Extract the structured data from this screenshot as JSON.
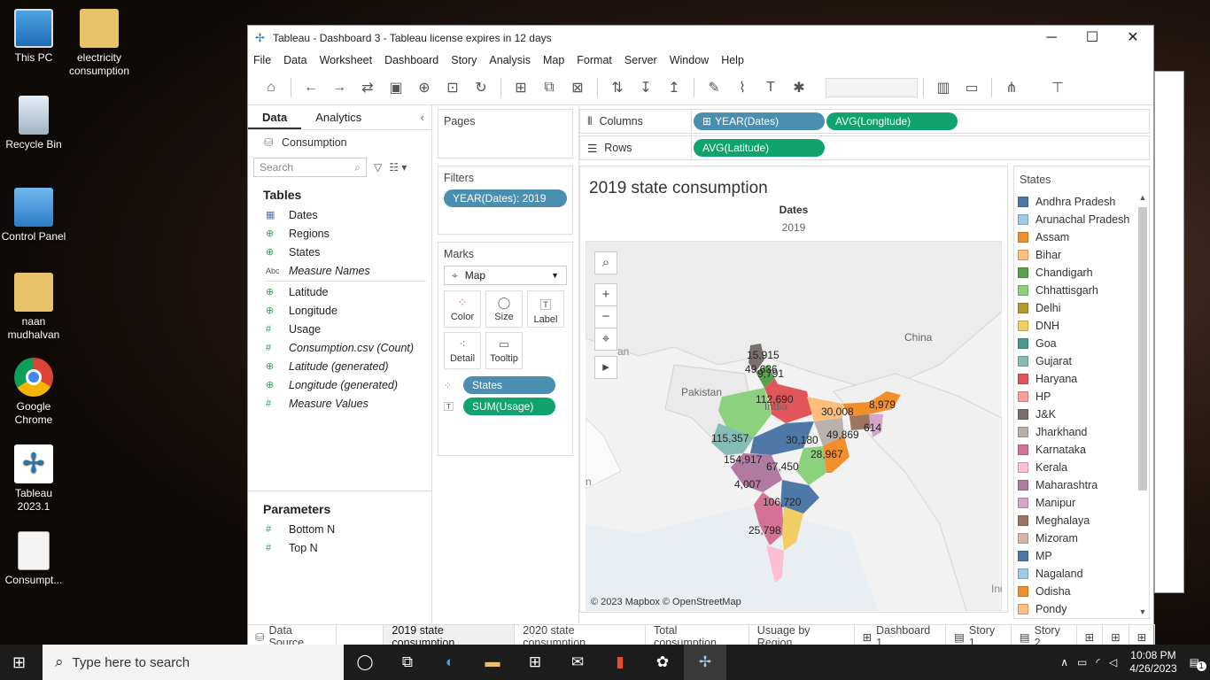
{
  "desktop": {
    "icons": [
      {
        "label": "This PC"
      },
      {
        "label": "electricity consumption"
      },
      {
        "label": "Recycle Bin"
      },
      {
        "label": "Control Panel"
      },
      {
        "label": "naan mudhalvan"
      },
      {
        "label": "Google Chrome"
      },
      {
        "label": "Tableau 2023.1"
      },
      {
        "label": "Consumpt..."
      }
    ]
  },
  "window": {
    "title": "Tableau - Dashboard 3 - Tableau license expires in 12 days",
    "controls": {
      "minimize": "─",
      "maximize": "☐",
      "close": "✕"
    }
  },
  "menu": [
    "File",
    "Data",
    "Worksheet",
    "Dashboard",
    "Story",
    "Analysis",
    "Map",
    "Format",
    "Server",
    "Window",
    "Help"
  ],
  "data_pane": {
    "tabs": [
      "Data",
      "Analytics"
    ],
    "datasource": "Consumption",
    "search_placeholder": "Search",
    "tables_title": "Tables",
    "fields": [
      {
        "name": "Dates",
        "type": "table",
        "italic": false
      },
      {
        "name": "Regions",
        "type": "geo",
        "italic": false
      },
      {
        "name": "States",
        "type": "geo",
        "italic": false
      },
      {
        "name": "Measure Names",
        "type": "abc",
        "italic": true
      },
      {
        "name": "Latitude",
        "type": "geo",
        "italic": false
      },
      {
        "name": "Longitude",
        "type": "geo",
        "italic": false
      },
      {
        "name": "Usage",
        "type": "measure",
        "italic": false
      },
      {
        "name": "Consumption.csv (Count)",
        "type": "measure",
        "italic": true
      },
      {
        "name": "Latitude (generated)",
        "type": "geo",
        "italic": true
      },
      {
        "name": "Longitude (generated)",
        "type": "geo",
        "italic": true
      },
      {
        "name": "Measure Values",
        "type": "measure",
        "italic": true
      }
    ],
    "parameters_title": "Parameters",
    "parameters": [
      "Bottom N",
      "Top N"
    ]
  },
  "cards": {
    "pages_title": "Pages",
    "filters_title": "Filters",
    "filter_pill": "YEAR(Dates): 2019",
    "marks_title": "Marks",
    "mark_type": "Map",
    "mark_buttons": [
      "Color",
      "Size",
      "Label",
      "Detail",
      "Tooltip"
    ],
    "mark_pills": [
      "States",
      "SUM(Usage)"
    ]
  },
  "shelves": {
    "columns_label": "Columns",
    "columns_pills": [
      "YEAR(Dates)",
      "AVG(Longitude)"
    ],
    "rows_label": "Rows",
    "rows_pills": [
      "AVG(Latitude)"
    ]
  },
  "view": {
    "title": "2019 state consumption",
    "column_header": "Dates",
    "column_value": "2019",
    "map_labels": {
      "pakistan": "Pakistan",
      "china": "China",
      "india": "India",
      "an": "an",
      "n": "n",
      "ind": "Ind"
    },
    "data_labels": [
      "15,915",
      "49,636",
      "9,791",
      "112,690",
      "30,008",
      "8,979",
      "614",
      "49,869",
      "115,357",
      "30,180",
      "28,967",
      "154,917",
      "67,450",
      "4,007",
      "106,720",
      "25,798"
    ],
    "attribution": "© 2023 Mapbox © OpenStreetMap"
  },
  "legend": {
    "title": "States",
    "items": [
      {
        "name": "Andhra Pradesh",
        "color": "#4e79a7"
      },
      {
        "name": "Arunachal Pradesh",
        "color": "#a0cbe8"
      },
      {
        "name": "Assam",
        "color": "#f28e2b"
      },
      {
        "name": "Bihar",
        "color": "#ffbe7d"
      },
      {
        "name": "Chandigarh",
        "color": "#59a14f"
      },
      {
        "name": "Chhattisgarh",
        "color": "#8cd17d"
      },
      {
        "name": "Delhi",
        "color": "#b6992d"
      },
      {
        "name": "DNH",
        "color": "#f1ce63"
      },
      {
        "name": "Goa",
        "color": "#499894"
      },
      {
        "name": "Gujarat",
        "color": "#86bcb6"
      },
      {
        "name": "Haryana",
        "color": "#e15759"
      },
      {
        "name": "HP",
        "color": "#ff9d9a"
      },
      {
        "name": "J&K",
        "color": "#79706e"
      },
      {
        "name": "Jharkhand",
        "color": "#bab0ac"
      },
      {
        "name": "Karnataka",
        "color": "#d37295"
      },
      {
        "name": "Kerala",
        "color": "#fabfd2"
      },
      {
        "name": "Maharashtra",
        "color": "#b07aa1"
      },
      {
        "name": "Manipur",
        "color": "#d4a6c8"
      },
      {
        "name": "Meghalaya",
        "color": "#9d7660"
      },
      {
        "name": "Mizoram",
        "color": "#d7b5a6"
      },
      {
        "name": "MP",
        "color": "#4e79a7"
      },
      {
        "name": "Nagaland",
        "color": "#a0cbe8"
      },
      {
        "name": "Odisha",
        "color": "#f28e2b"
      },
      {
        "name": "Pondy",
        "color": "#ffbe7d"
      }
    ]
  },
  "sheet_tabs": [
    "Data Source",
    "2019 state consumption",
    "2020 state consumption",
    "Total consumption",
    "Usuage by Region",
    "Dashboard 1",
    "Story 1",
    "Story 2"
  ],
  "taskbar": {
    "search_placeholder": "Type here to search",
    "time": "10:08 PM",
    "date": "4/26/2023",
    "notification_count": "1"
  }
}
